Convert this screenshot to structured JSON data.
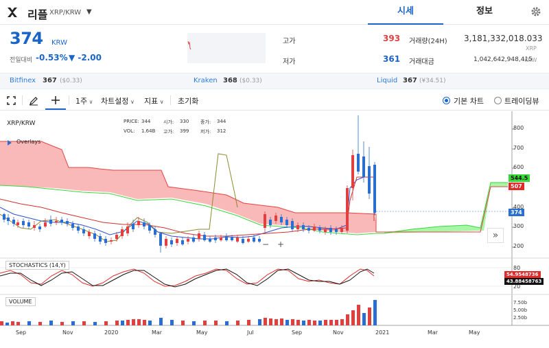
{
  "header": {
    "coin_name": "리플",
    "pair": "XRP/KRW",
    "tabs": [
      "시세",
      "정보"
    ]
  },
  "price": {
    "current": "374",
    "unit": "KRW",
    "change_label": "전일대비",
    "change_pct": "-0.53%",
    "change_abs": "▼ -2.00"
  },
  "stats": {
    "high_label": "고가",
    "high": "393",
    "low_label": "저가",
    "low": "361",
    "volume_label": "거래량(24H)",
    "volume": "3,181,332,018.033",
    "volume_unit": "XRP",
    "amount_label": "거래대금",
    "amount": "1,042,642,948,415",
    "amount_unit": "KRW"
  },
  "exchanges": [
    {
      "name": "Bitfinex",
      "price": "367",
      "sub": "($0.33)"
    },
    {
      "name": "Kraken",
      "price": "368",
      "sub": "($0.33)"
    },
    {
      "name": "Liquid",
      "price": "367",
      "sub": "(¥34.51)"
    }
  ],
  "toolbar": {
    "interval": "1주",
    "chart_settings": "차트설정",
    "indicators": "지표",
    "reset": "초기화",
    "basic_chart": "기본 차트",
    "trading_view": "트레이딩뷰"
  },
  "chart": {
    "symbol": "XRP/KRW",
    "overlays": "Overlays",
    "info_price_label": "PRICE:",
    "info_price": "344",
    "info_open_label": "시가:",
    "info_open": "330",
    "info_close_label": "종가:",
    "info_close": "344",
    "info_vol_label": "VOL:",
    "info_vol": "1.64B",
    "info_high_label": "고가:",
    "info_high": "399",
    "info_low_label": "저가:",
    "info_low": "312",
    "price_ticks": [
      "800",
      "700",
      "600",
      "400",
      "300",
      "200"
    ],
    "price_badges": {
      "last": "374",
      "cloud_a": "544.5",
      "cloud_b": "507"
    },
    "stoch_title": "STOCHASTICS (14,Y)",
    "stoch_ticks": [
      "80",
      "20"
    ],
    "stoch_badge_a": "54.9548736",
    "stoch_badge_b": "43.88458763",
    "volume_title": "VOLUME",
    "volume_ticks": [
      "7.50b",
      "5.00b",
      "2.50b"
    ],
    "x_ticks": [
      "Sep",
      "Nov",
      "2020",
      "Mar",
      "May",
      "Jul",
      "Sep",
      "Nov",
      "2021",
      "Mar",
      "May"
    ],
    "colors": {
      "up": "#e04040",
      "down": "#2a6fcf",
      "cloud_bull": "#f9a7a7",
      "cloud_bear": "#9ef59e"
    }
  }
}
